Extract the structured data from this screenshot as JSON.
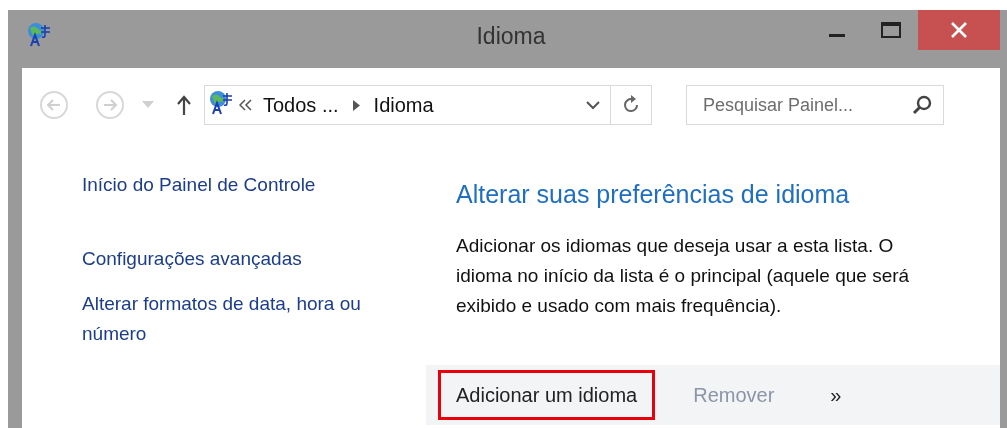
{
  "window": {
    "title": "Idioma"
  },
  "address_bar": {
    "crumbs": [
      "Todos ...",
      "Idioma"
    ]
  },
  "search": {
    "placeholder": "Pesquisar Painel..."
  },
  "sidebar": {
    "links": [
      "Início do Painel de Controle",
      "Configurações avançadas",
      "Alterar formatos de data, hora ou número"
    ]
  },
  "main": {
    "heading": "Alterar suas preferências de idioma",
    "description": "Adicionar os idiomas que deseja usar a esta lista. O idioma no início da lista é o principal (aquele que será exibido e usado com mais frequência)."
  },
  "toolbar": [
    {
      "label": "Adicionar um idioma",
      "disabled": false,
      "highlighted": true
    },
    {
      "label": "Remover",
      "disabled": true,
      "highlighted": false
    },
    {
      "label": "»",
      "disabled": false,
      "highlighted": false
    }
  ]
}
